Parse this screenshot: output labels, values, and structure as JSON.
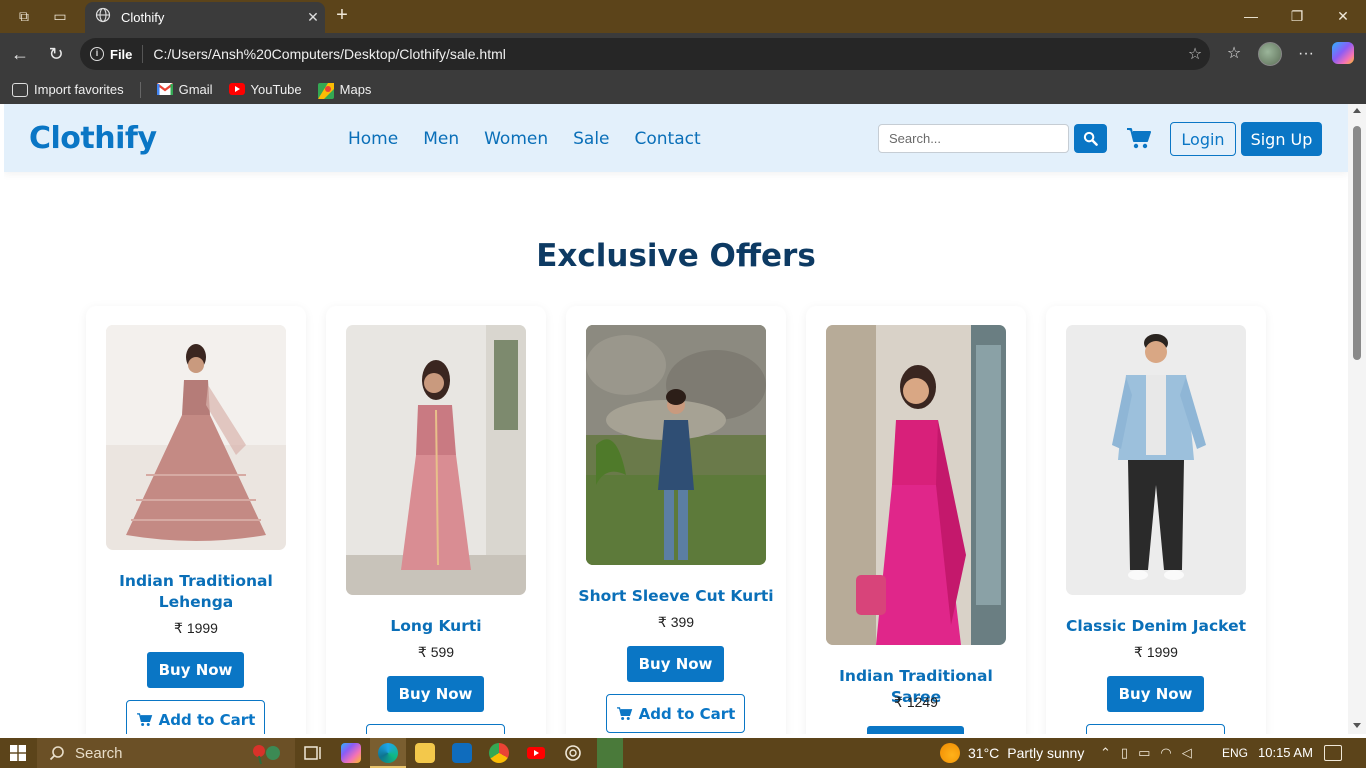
{
  "browser": {
    "tab_title": "Clothify",
    "site_info_label": "File",
    "url": "C:/Users/Ansh%20Computers/Desktop/Clothify/sale.html",
    "bookmarks": [
      "Import favorites",
      "Gmail",
      "YouTube",
      "Maps"
    ]
  },
  "site": {
    "logo": "Clothify",
    "nav": [
      "Home",
      "Men",
      "Women",
      "Sale",
      "Contact"
    ],
    "search_placeholder": "Search...",
    "login_label": "Login",
    "signup_label": "Sign Up",
    "section_title": "Exclusive Offers",
    "buy_label": "Buy Now",
    "cart_label": "Add to Cart",
    "products": [
      {
        "name": "Indian Traditional Lehenga",
        "price": "₹ 1999"
      },
      {
        "name": "Long Kurti",
        "price": "₹ 599"
      },
      {
        "name": "Short Sleeve Cut Kurti",
        "price": "₹ 399"
      },
      {
        "name": "Indian Traditional Saree",
        "price": "₹ 1249"
      },
      {
        "name": "Classic Denim Jacket",
        "price": "₹ 1999"
      }
    ]
  },
  "taskbar": {
    "search_text": "Search",
    "weather_temp": "31°C",
    "weather_desc": "Partly sunny",
    "language": "ENG",
    "time": "10:15 AM"
  },
  "colors": {
    "brand": "#0a76c5",
    "header_bg": "#e3f0fb",
    "title": "#0d3a63"
  }
}
